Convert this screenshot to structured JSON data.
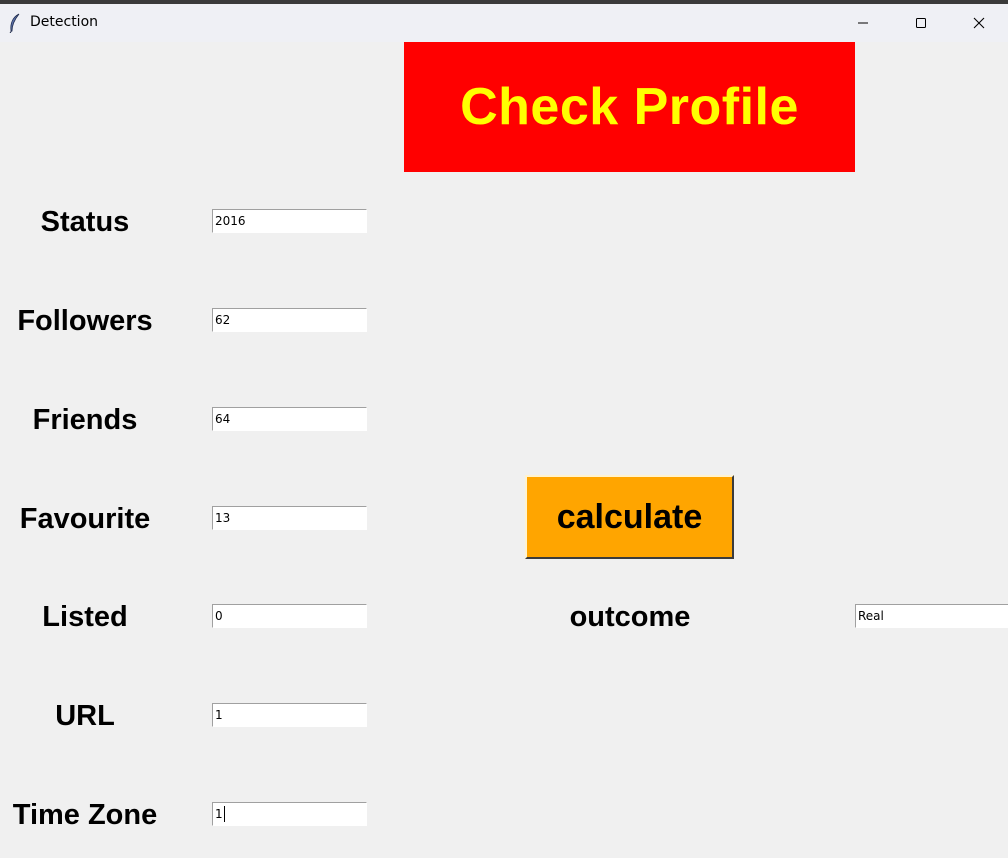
{
  "window": {
    "title": "Detection",
    "app_icon": "feather-icon",
    "controls": {
      "minimize_icon": "minimize-icon",
      "maximize_icon": "maximize-icon",
      "close_icon": "close-icon"
    }
  },
  "header": {
    "title": "Check Profile",
    "background_color": "#ff0000",
    "text_color": "#ffff00"
  },
  "fields": [
    {
      "label": "Status",
      "value": "2016"
    },
    {
      "label": "Followers",
      "value": "62"
    },
    {
      "label": "Friends",
      "value": "64"
    },
    {
      "label": "Favourite",
      "value": "13"
    },
    {
      "label": "Listed",
      "value": "0"
    },
    {
      "label": "URL",
      "value": "1"
    },
    {
      "label": "Time Zone",
      "value": "1"
    }
  ],
  "calculate_button": {
    "label": "calculate",
    "background_color": "#ffa500"
  },
  "outcome": {
    "label": "outcome",
    "value": "Real"
  }
}
